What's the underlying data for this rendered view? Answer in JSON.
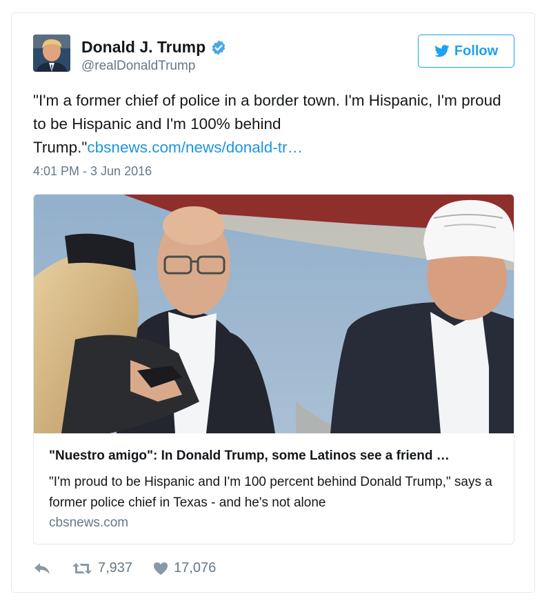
{
  "author": {
    "name": "Donald J. Trump",
    "handle": "@realDonaldTrump",
    "verified": true
  },
  "follow_button": {
    "label": "Follow"
  },
  "tweet": {
    "text": "\"I'm a former chief of police in a border town. I'm Hispanic, I'm proud to be Hispanic and I'm 100% behind Trump.\"",
    "link_text": "cbsnews.com/news/donald-tr…",
    "timestamp": "4:01 PM - 3 Jun 2016"
  },
  "card": {
    "title": "\"Nuestro amigo\": In Donald Trump, some Latinos see a friend …",
    "description": "\"I'm proud to be Hispanic and I'm 100 percent behind Donald Trump,\" says a former police chief in Texas - and he's not alone",
    "domain": "cbsnews.com"
  },
  "actions": {
    "retweets": "7,937",
    "likes": "17,076"
  },
  "colors": {
    "accent": "#1da1f2",
    "link": "#1b95e0",
    "muted": "#657786",
    "border": "#e1e8ed"
  },
  "icons": [
    "verified-badge-icon",
    "bird-icon",
    "reply-icon",
    "retweet-icon",
    "heart-icon"
  ]
}
